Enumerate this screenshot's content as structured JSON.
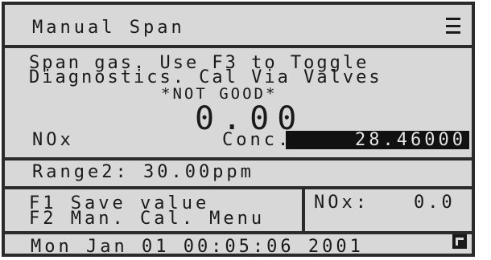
{
  "header": {
    "title": "Manual Span",
    "menu_icon": "list-icon"
  },
  "message": {
    "line1": "Span gas. Use F3 to Toggle",
    "line2": "Diagnostics. Cal Via Valves",
    "status": "*NOT GOOD*"
  },
  "reading": {
    "value": "0.00",
    "gas_label": "NOx",
    "conc_label": "Conc.:",
    "conc_value": "28.46000"
  },
  "range": {
    "text": "Range2: 30.00ppm"
  },
  "function_keys": {
    "f1_label": "F1 Save value",
    "f2_label": "F2 Man. Cal. Menu"
  },
  "side_reading": {
    "label": "NOx:",
    "value": "0.0"
  },
  "footer": {
    "datetime": "Mon Jan 01 00:05:06 2001",
    "mode_icon": "lock-icon"
  }
}
